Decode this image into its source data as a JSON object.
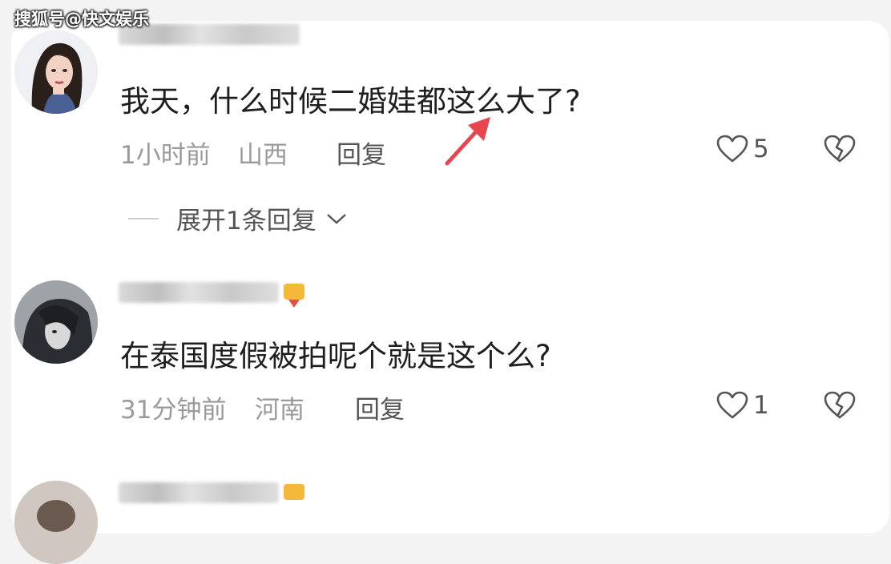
{
  "watermark": "搜狐号@快文娱乐",
  "comments": [
    {
      "avatar": "avatar-woman",
      "text": "我天，什么时候二婚娃都这么大了?",
      "time": "1小时前",
      "location": "山西",
      "reply_label": "回复",
      "likes": "5",
      "expand_label": "展开1条回复"
    },
    {
      "avatar": "avatar-dark",
      "text": "在泰国度假被拍呢个就是这个么?",
      "time": "31分钟前",
      "location": "河南",
      "reply_label": "回复",
      "likes": "1"
    }
  ],
  "colors": {
    "arrow": "#e8454f",
    "badge": "#f4b93a",
    "meta_text": "#9a9a9a"
  }
}
